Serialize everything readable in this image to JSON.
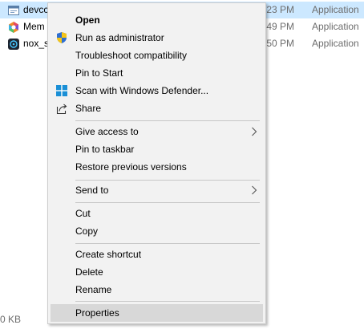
{
  "files": [
    {
      "name": "devcc",
      "time": "23 PM",
      "type": "Application",
      "icon": "app-window-icon",
      "selected": true
    },
    {
      "name": "Mem",
      "time": "49 PM",
      "type": "Application",
      "icon": "memu-logo-icon",
      "selected": false
    },
    {
      "name": "nox_s",
      "time": "50 PM",
      "type": "Application",
      "icon": "nox-logo-icon",
      "selected": false
    }
  ],
  "status": {
    "size": "0 KB"
  },
  "context_menu": {
    "open": "Open",
    "run_as_admin": "Run as administrator",
    "troubleshoot": "Troubleshoot compatibility",
    "pin_start": "Pin to Start",
    "scan_defender": "Scan with Windows Defender...",
    "share": "Share",
    "give_access": "Give access to",
    "pin_taskbar": "Pin to taskbar",
    "restore_versions": "Restore previous versions",
    "send_to": "Send to",
    "cut": "Cut",
    "copy": "Copy",
    "create_shortcut": "Create shortcut",
    "delete": "Delete",
    "rename": "Rename",
    "properties": "Properties"
  },
  "colors": {
    "selection": "#cce8ff",
    "menu_background": "#f2f2f2",
    "menu_hover": "#d8d8d8",
    "secondary_text": "#6d6d6d"
  }
}
